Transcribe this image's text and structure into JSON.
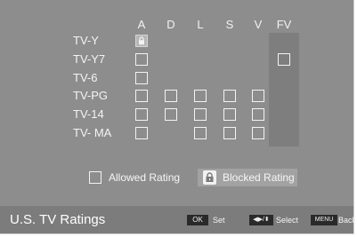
{
  "columns": [
    "A",
    "D",
    "L",
    "S",
    "V",
    "FV"
  ],
  "rows": [
    {
      "label": "TV-Y",
      "cells": [
        "blocked",
        null,
        null,
        null,
        null,
        null
      ]
    },
    {
      "label": "TV-Y7",
      "cells": [
        "allowed",
        null,
        null,
        null,
        null,
        "allowed"
      ]
    },
    {
      "label": "TV-6",
      "cells": [
        "allowed",
        null,
        null,
        null,
        null,
        null
      ]
    },
    {
      "label": "TV-PG",
      "cells": [
        "allowed",
        "allowed",
        "allowed",
        "allowed",
        "allowed",
        null
      ]
    },
    {
      "label": "TV-14",
      "cells": [
        "allowed",
        "allowed",
        "allowed",
        "allowed",
        "allowed",
        null
      ]
    },
    {
      "label": "TV- MA",
      "cells": [
        "allowed",
        null,
        "allowed",
        "allowed",
        "allowed",
        null
      ]
    }
  ],
  "legend": {
    "allowed_label": "Allowed Rating",
    "blocked_label": "Blocked Rating"
  },
  "footer": {
    "title": "U.S. TV Ratings",
    "ok_key": "OK",
    "ok_label": "Set",
    "select_key": "◀▶/⬍",
    "select_label": "Select",
    "menu_key": "MENU",
    "menu_label": "Back"
  }
}
